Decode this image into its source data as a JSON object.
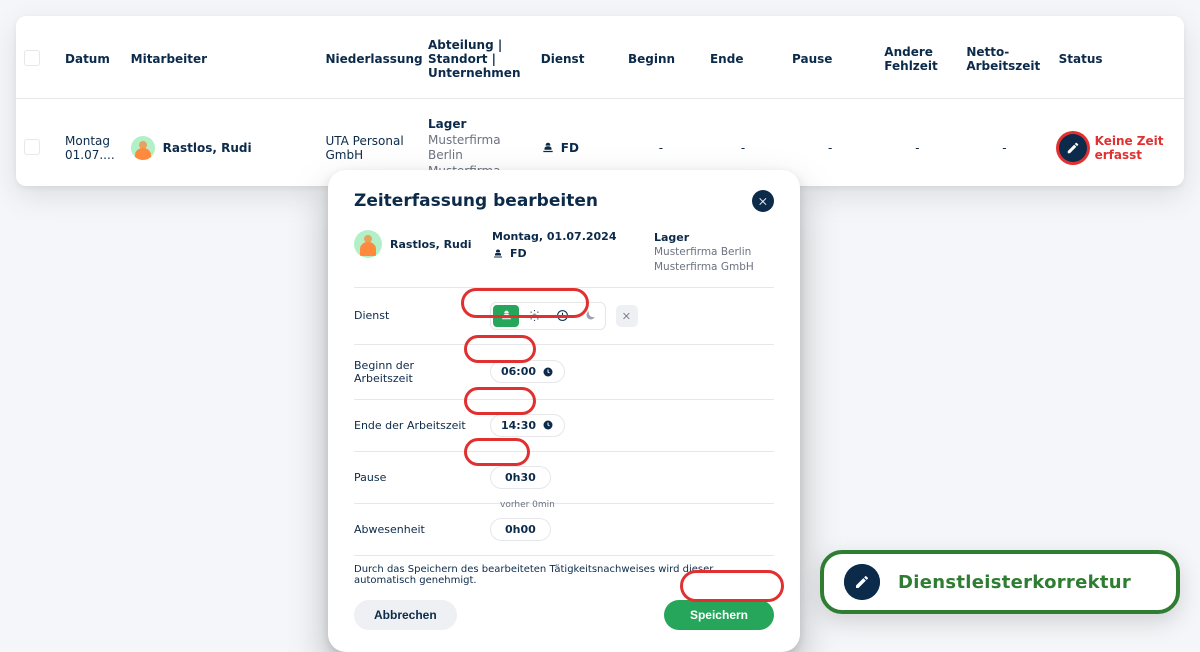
{
  "table": {
    "headers": {
      "date": "Datum",
      "employee": "Mitarbeiter",
      "branch": "Niederlassung",
      "dept": "Abteilung | Standort | Unternehmen",
      "service": "Dienst",
      "begin": "Beginn",
      "end": "Ende",
      "pause": "Pause",
      "absence": "Andere Fehlzeit",
      "net": "Netto-Arbeitszeit",
      "status": "Status"
    },
    "row": {
      "date": "Montag 01.07....",
      "employee": "Rastlos, Rudi",
      "branch": "UTA Personal GmbH",
      "dept_main": "Lager",
      "dept_sub1": "Musterfirma Berlin",
      "dept_sub2": "Musterfirma",
      "service": "FD",
      "begin": "-",
      "end": "-",
      "pause": "-",
      "absence": "-",
      "net": "-",
      "status": "Keine Zeit erfasst"
    }
  },
  "modal": {
    "title": "Zeiterfassung bearbeiten",
    "employee": "Rastlos, Rudi",
    "date": "Montag, 01.07.2024",
    "service": "FD",
    "dept_main": "Lager",
    "dept_sub1": "Musterfirma Berlin",
    "dept_sub2": "Musterfirma GmbH",
    "labels": {
      "service": "Dienst",
      "begin": "Beginn der Arbeitszeit",
      "end": "Ende der Arbeitszeit",
      "pause": "Pause",
      "absence": "Abwesenheit"
    },
    "values": {
      "begin": "06:00",
      "end": "14:30",
      "pause": "0h30",
      "pause_prev": "vorher 0min",
      "absence": "0h00"
    },
    "note": "Durch das Speichern des bearbeiteten Tätigkeitsnachweises wird dieser automatisch genehmigt.",
    "buttons": {
      "cancel": "Abbrechen",
      "save": "Speichern"
    }
  },
  "status_pill": {
    "label": "Dienstleisterkorrektur"
  }
}
